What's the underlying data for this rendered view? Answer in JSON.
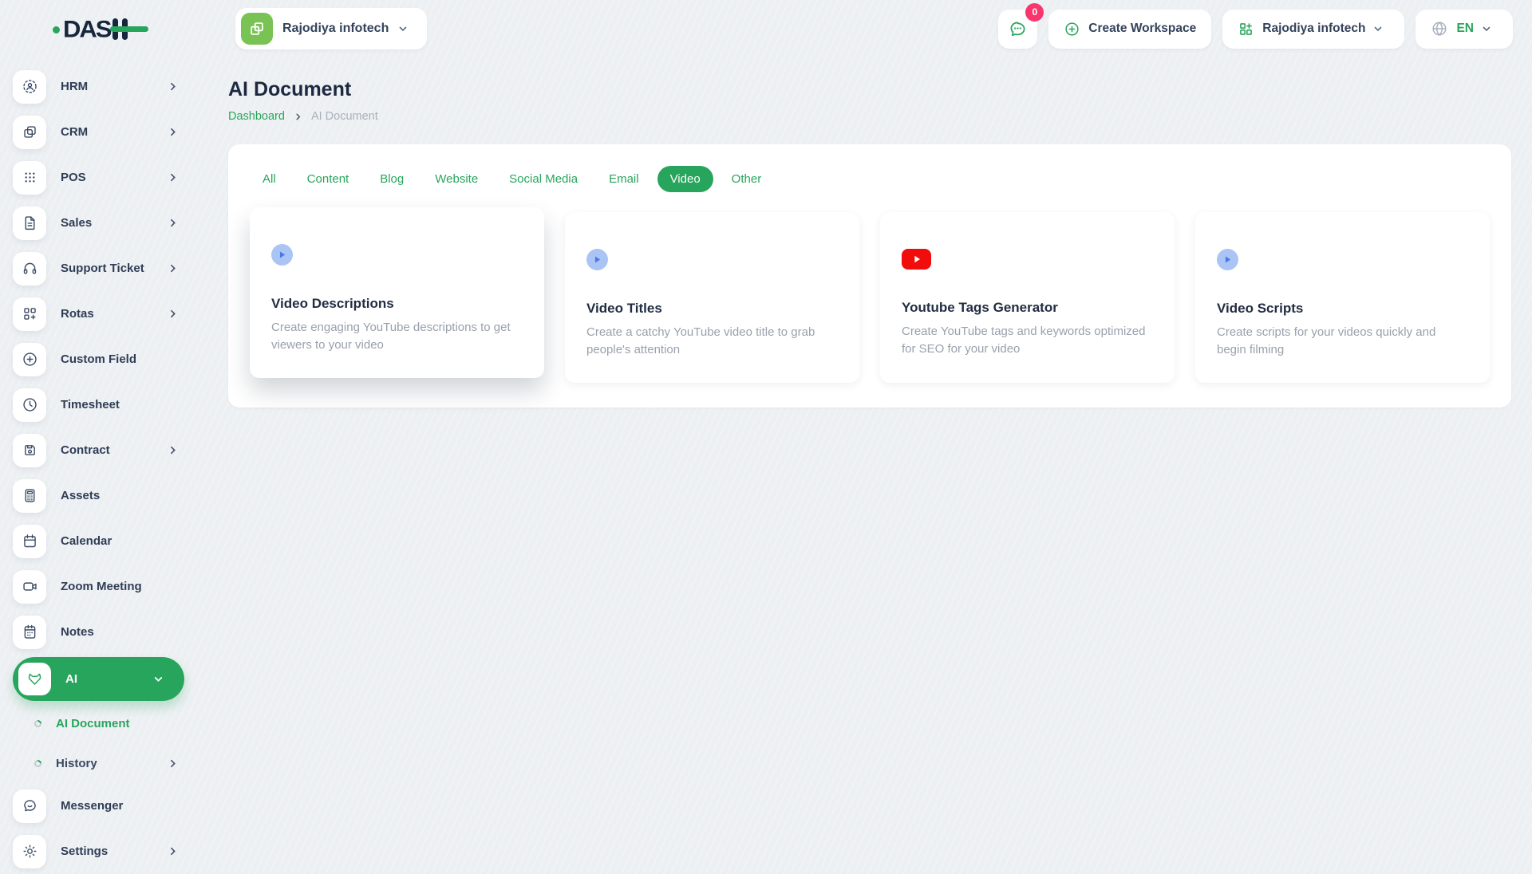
{
  "brand": {
    "name": "DAS"
  },
  "header": {
    "workspace": {
      "label": "Rajodiya infotech",
      "icon": "workspace-logo"
    },
    "messages": {
      "badge": "0",
      "icon": "chat-icon"
    },
    "create_workspace": {
      "label": "Create Workspace",
      "icon": "plus-circle-icon"
    },
    "account": {
      "label": "Rajodiya infotech",
      "icon": "workspace-grid-icon"
    },
    "language": {
      "label": "EN",
      "icon": "globe-icon"
    }
  },
  "sidebar": {
    "items": [
      {
        "label": "HRM",
        "icon": "hrm-icon",
        "expandable": true
      },
      {
        "label": "CRM",
        "icon": "crm-icon",
        "expandable": true
      },
      {
        "label": "POS",
        "icon": "pos-icon",
        "expandable": true
      },
      {
        "label": "Sales",
        "icon": "sales-icon",
        "expandable": true
      },
      {
        "label": "Support Ticket",
        "icon": "support-ticket-icon",
        "expandable": true
      },
      {
        "label": "Rotas",
        "icon": "rotas-icon",
        "expandable": true
      },
      {
        "label": "Custom Field",
        "icon": "custom-field-icon",
        "expandable": false
      },
      {
        "label": "Timesheet",
        "icon": "timesheet-icon",
        "expandable": false
      },
      {
        "label": "Contract",
        "icon": "contract-icon",
        "expandable": true
      },
      {
        "label": "Assets",
        "icon": "assets-icon",
        "expandable": false
      },
      {
        "label": "Calendar",
        "icon": "calendar-icon",
        "expandable": false
      },
      {
        "label": "Zoom Meeting",
        "icon": "zoom-meeting-icon",
        "expandable": false
      },
      {
        "label": "Notes",
        "icon": "notes-icon",
        "expandable": false
      },
      {
        "label": "AI",
        "icon": "ai-icon",
        "expandable": true,
        "active": true,
        "expanded": true
      },
      {
        "label": "Messenger",
        "icon": "messenger-icon",
        "expandable": false
      },
      {
        "label": "Settings",
        "icon": "settings-icon",
        "expandable": true
      }
    ],
    "ai_children": [
      {
        "label": "AI Document",
        "active": true
      },
      {
        "label": "History",
        "expandable": true
      }
    ]
  },
  "page": {
    "title": "AI Document",
    "breadcrumb": {
      "root": "Dashboard",
      "current": "AI Document"
    }
  },
  "tabs": [
    {
      "label": "All"
    },
    {
      "label": "Content"
    },
    {
      "label": "Blog"
    },
    {
      "label": "Website"
    },
    {
      "label": "Social Media"
    },
    {
      "label": "Email"
    },
    {
      "label": "Video",
      "active": true
    },
    {
      "label": "Other"
    }
  ],
  "cards": [
    {
      "title": "Video Descriptions",
      "description": "Create engaging YouTube descriptions to get viewers to your video",
      "icon": "play-circle-icon"
    },
    {
      "title": "Video Titles",
      "description": "Create a catchy YouTube video title to grab people's attention",
      "icon": "play-circle-icon"
    },
    {
      "title": "Youtube Tags Generator",
      "description": "Create YouTube tags and keywords optimized for SEO for your video",
      "icon": "youtube-icon"
    },
    {
      "title": "Video Scripts",
      "description": "Create scripts for your videos quickly and begin filming",
      "icon": "play-circle-icon"
    }
  ],
  "colors": {
    "accent_green": "#28a55c",
    "badge_pink": "#f7366d",
    "youtube_red": "#f20d0d",
    "play_blue": "#4d77e3",
    "play_circle_bg": "#abc4f6",
    "logo_navy": "#16263c"
  }
}
